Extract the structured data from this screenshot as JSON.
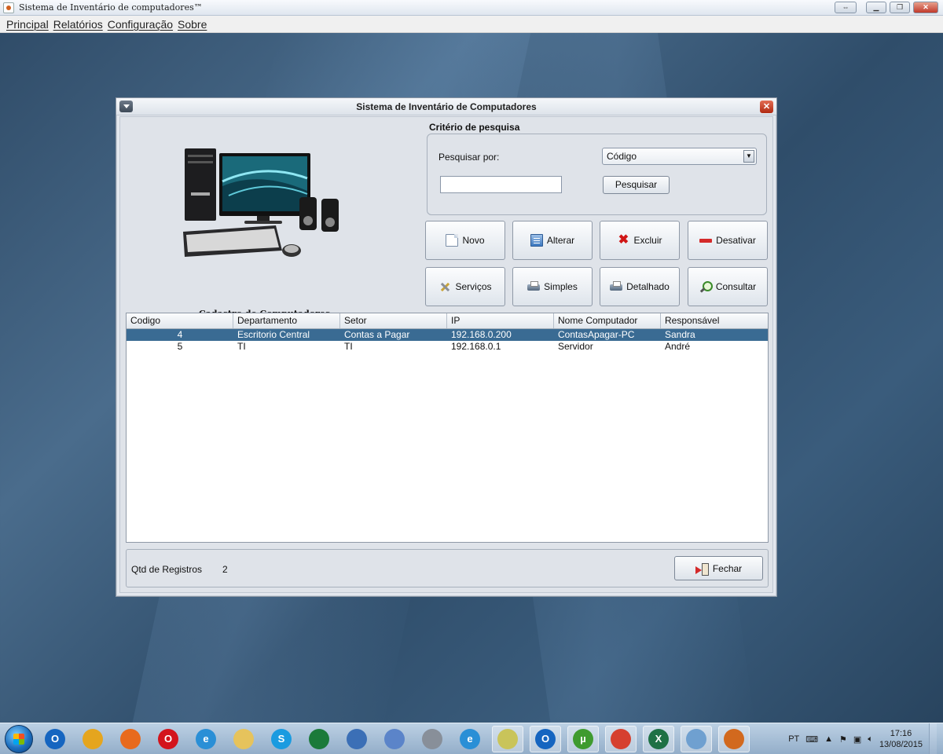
{
  "app": {
    "title": "Sistema de Inventário de computadores™",
    "menu": [
      "Principal",
      "Relatórios",
      "Configuração",
      "Sobre"
    ]
  },
  "window": {
    "title": "Sistema de Inventário de Computadores",
    "caption": "Cadastro de Computadores"
  },
  "search": {
    "group_label": "Critério de pesquisa",
    "by_label": "Pesquisar por:",
    "selected_option": "Código",
    "input_value": "",
    "button_label": "Pesquisar"
  },
  "actions": {
    "new": "Novo",
    "edit": "Alterar",
    "delete": "Excluir",
    "deactivate": "Desativar",
    "services": "Serviços",
    "simple": "Simples",
    "detailed": "Detalhado",
    "query": "Consultar"
  },
  "table": {
    "columns": [
      "Codigo",
      "Departamento",
      "Setor",
      "IP",
      "Nome Computador",
      "Responsável"
    ],
    "rows": [
      [
        "4",
        "Escritorio Central",
        "Contas a Pagar",
        "192.168.0.200",
        "ContasApagar-PC",
        "Sandra"
      ],
      [
        "5",
        "TI",
        "TI",
        "192.168.0.1",
        "Servidor",
        "André"
      ]
    ],
    "selected_row": 0
  },
  "footer": {
    "count_label": "Qtd de Registros",
    "count_value": "2",
    "close_label": "Fechar"
  },
  "taskbar": {
    "apps": [
      {
        "icon": "outlook-icon",
        "glyph": "O",
        "color": "#1565c0"
      },
      {
        "icon": "chrome-icon",
        "glyph": "",
        "color": "#e5a51e"
      },
      {
        "icon": "firefox-icon",
        "glyph": "",
        "color": "#e86a1d"
      },
      {
        "icon": "opera-icon",
        "glyph": "O",
        "color": "#d3141c"
      },
      {
        "icon": "ie-icon",
        "glyph": "e",
        "color": "#2a8fd6"
      },
      {
        "icon": "folder-icon",
        "glyph": "",
        "color": "#e6c35c"
      },
      {
        "icon": "skype-icon",
        "glyph": "S",
        "color": "#1a9be0"
      },
      {
        "icon": "eye-icon",
        "glyph": "",
        "color": "#1b7a3a"
      },
      {
        "icon": "network-icon",
        "glyph": "",
        "color": "#3b6fb6"
      },
      {
        "icon": "tools-icon",
        "glyph": "",
        "color": "#5b84c9"
      },
      {
        "icon": "camera-icon",
        "glyph": "",
        "color": "#888f99"
      },
      {
        "icon": "ie-icon",
        "glyph": "e",
        "color": "#2a8fd6"
      },
      {
        "icon": "explorer-icon",
        "glyph": "",
        "color": "#c9c45a"
      },
      {
        "icon": "outlook-icon",
        "glyph": "O",
        "color": "#1565c0"
      },
      {
        "icon": "utorrent-icon",
        "glyph": "µ",
        "color": "#3f9b2f"
      },
      {
        "icon": "chrome-icon",
        "glyph": "",
        "color": "#d6402f"
      },
      {
        "icon": "excel-icon",
        "glyph": "X",
        "color": "#1e7145"
      },
      {
        "icon": "window-icon",
        "glyph": "",
        "color": "#6fa0d0"
      },
      {
        "icon": "java-icon",
        "glyph": "",
        "color": "#d2691e"
      }
    ],
    "lang": "PT",
    "time": "17:16",
    "date": "13/08/2015"
  }
}
